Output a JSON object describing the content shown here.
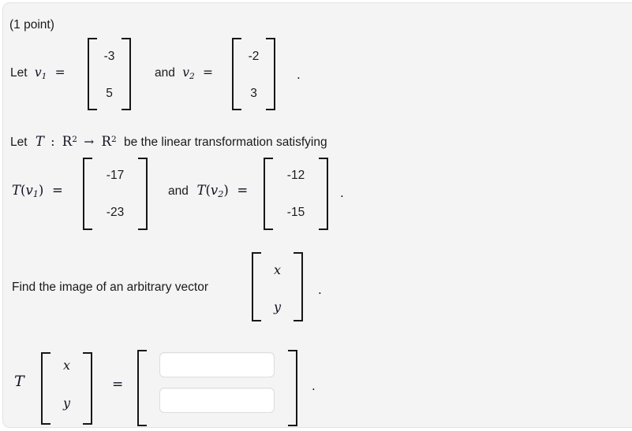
{
  "problem": {
    "points_label": "(1 point)",
    "line1": {
      "lead": "Let",
      "var1": "v",
      "var1_sub": "1",
      "equals": "=",
      "conj": "and",
      "var2": "v",
      "var2_sub": "2",
      "equals2": "=",
      "v1": [
        "-3",
        "5"
      ],
      "v2": [
        "-2",
        "3"
      ],
      "period": "."
    },
    "line2": {
      "lead": "Let",
      "T": "T",
      "colon": ":",
      "domain": "R",
      "domain_exp": "2",
      "arrow": "→",
      "codomain": "R",
      "codomain_exp": "2",
      "tail": "be the linear transformation satisfying"
    },
    "line3": {
      "tv1_fn": "T",
      "tv1_open": "(",
      "tv1_var": "v",
      "tv1_sub": "1",
      "tv1_close": ")",
      "equals": "=",
      "conj": "and",
      "tv2_fn": "T",
      "tv2_open": "(",
      "tv2_var": "v",
      "tv2_sub": "2",
      "tv2_close": ")",
      "equals2": "=",
      "tv1": [
        "-17",
        "-23"
      ],
      "tv2": [
        "-12",
        "-15"
      ],
      "period": "."
    },
    "line4": {
      "prompt": "Find the image of an arbitrary vector",
      "vector": [
        "x",
        "y"
      ],
      "period": "."
    },
    "answer": {
      "T": "T",
      "vector": [
        "x",
        "y"
      ],
      "equals": "=",
      "field1_value": "",
      "field2_value": "",
      "field1_placeholder": "",
      "field2_placeholder": "",
      "period": "."
    }
  },
  "colors": {
    "card_background": "#f4f4f4",
    "card_border": "#e2e2e2",
    "text": "#1a1a1a",
    "math_text": "#111122",
    "bracket": "#171717",
    "input_background": "#ffffff",
    "input_border": "#dddddd"
  }
}
